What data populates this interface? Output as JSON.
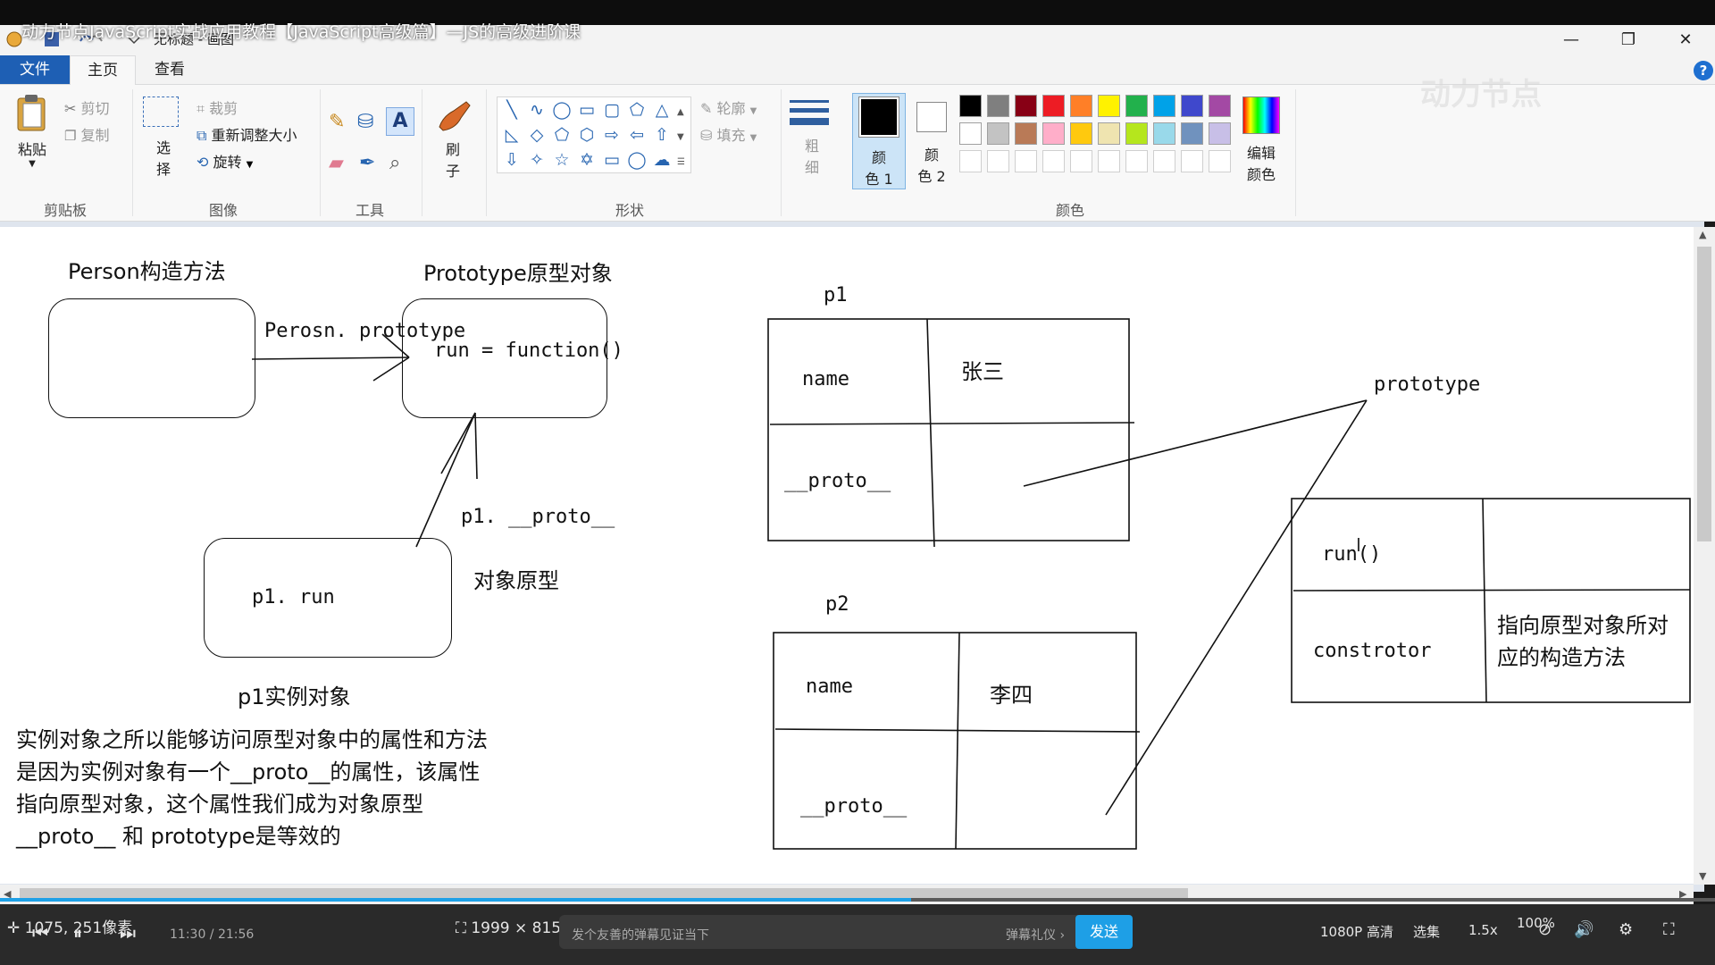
{
  "video": {
    "title": "动力节点JavaScript实战应用教程【JavaScript高级篇】—JS的高级进阶课",
    "watermark": "动力节点"
  },
  "window": {
    "doc_title": "无标题 - 画图",
    "minimize": "—",
    "restore": "❐",
    "close": "✕"
  },
  "tabs": {
    "file": "文件",
    "home": "主页",
    "view": "查看",
    "help": "?"
  },
  "ribbon": {
    "clipboard": {
      "paste": "粘贴",
      "cut": "剪切",
      "copy": "复制",
      "group": "剪贴板"
    },
    "image": {
      "select_top": "选",
      "select_bottom": "择",
      "crop": "裁剪",
      "resize": "重新调整大小",
      "rotate": "旋转",
      "group": "图像"
    },
    "tools": {
      "group": "工具"
    },
    "brush": {
      "top": "刷",
      "bottom": "子"
    },
    "shapes": {
      "outline": "轮廓",
      "fill": "填充",
      "group": "形状"
    },
    "size": {
      "top": "粗",
      "bottom": "细"
    },
    "color1": {
      "top": "颜",
      "bottom": "色 1"
    },
    "color2": {
      "top": "颜",
      "bottom": "色 2"
    },
    "edit_colors": {
      "top": "编辑",
      "bottom": "颜色"
    },
    "colors_group": "颜色",
    "palette_row1": [
      "#000000",
      "#7f7f7f",
      "#880015",
      "#ed1c24",
      "#ff7f27",
      "#fff200",
      "#22b14c",
      "#00a2e8",
      "#3f48cc",
      "#a349a4"
    ],
    "palette_row2": [
      "#ffffff",
      "#c3c3c3",
      "#b97a57",
      "#ffaec9",
      "#ffc90e",
      "#efe4b0",
      "#b5e61d",
      "#99d9ea",
      "#7092be",
      "#c8bfe7"
    ]
  },
  "canvas": {
    "person_label": "Person构造方法",
    "prototype_label": "Prototype原型对象",
    "arrow_label": "Perosn. prototype",
    "run_fn": "run = function()",
    "p1_proto_label": "p1. __proto__",
    "object_proto_label": "对象原型",
    "p1_run": "p1. run",
    "p1_instance_label": "p1实例对象",
    "explanation": [
      "实例对象之所以能够访问原型对象中的属性和方法",
      "是因为实例对象有一个__proto__的属性，该属性",
      "指向原型对象，这个属性我们成为对象原型",
      "__proto__  和  prototype是等效的"
    ],
    "p1_title": "p1",
    "p1_name_key": "name",
    "p1_name_val": "张三",
    "p1_proto_key": "__proto__",
    "p2_title": "p2",
    "p2_name_key": "name",
    "p2_name_val": "李四",
    "p2_proto_key": "__proto__",
    "prototype_word": "prototype",
    "proto_run": "run()",
    "constructor_key": "constrotor",
    "constructor_val_line1": "指向原型对象所对",
    "constructor_val_line2": "应的构造方法"
  },
  "status": {
    "cursor_pos": "1075, 251像素",
    "canvas_size": "1999 × 815像素",
    "zoom": "100%"
  },
  "player": {
    "time": "11:30 / 21:56",
    "danmaku_placeholder": "发个友善的弹幕见证当下",
    "danmaku_etiquette": "弹幕礼仪 ›",
    "send": "发送",
    "quality": "1080P 高清",
    "episodes": "选集",
    "speed": "1.5x"
  }
}
